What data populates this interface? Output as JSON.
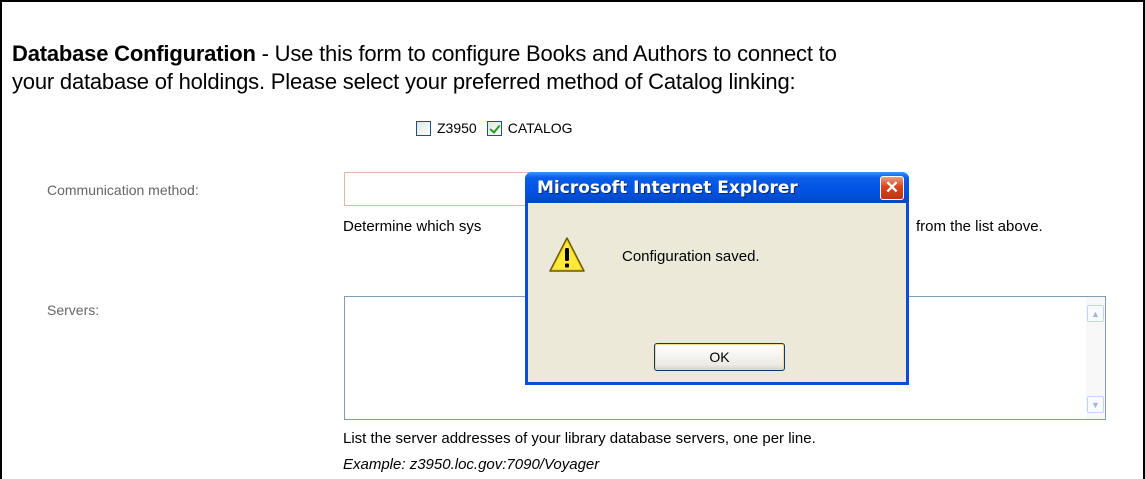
{
  "heading": {
    "title": "Database Configuration",
    "description_line1": " - Use this form to configure Books and Authors to connect to",
    "description_line2": "your database of holdings. Please select your preferred method of Catalog linking:"
  },
  "linking_options": [
    {
      "label": "Z3950",
      "checked": false
    },
    {
      "label": "CATALOG",
      "checked": true
    }
  ],
  "communication": {
    "label": "Communication method:",
    "value": "",
    "help_left": "Determine which sys",
    "help_right": "from the list above."
  },
  "servers": {
    "label": "Servers:",
    "value": "",
    "help": "List the server addresses of your library database servers, one per line.",
    "example": "Example: z3950.loc.gov:7090/Voyager"
  },
  "dialog": {
    "title": "Microsoft Internet Explorer",
    "icon": "warning-icon",
    "message": "Configuration saved.",
    "ok_label": "OK",
    "close_glyph": "✕"
  },
  "colors": {
    "titlebar": "#0053e3",
    "dialog_body": "#ece9d8",
    "close_button": "#d8431c"
  }
}
